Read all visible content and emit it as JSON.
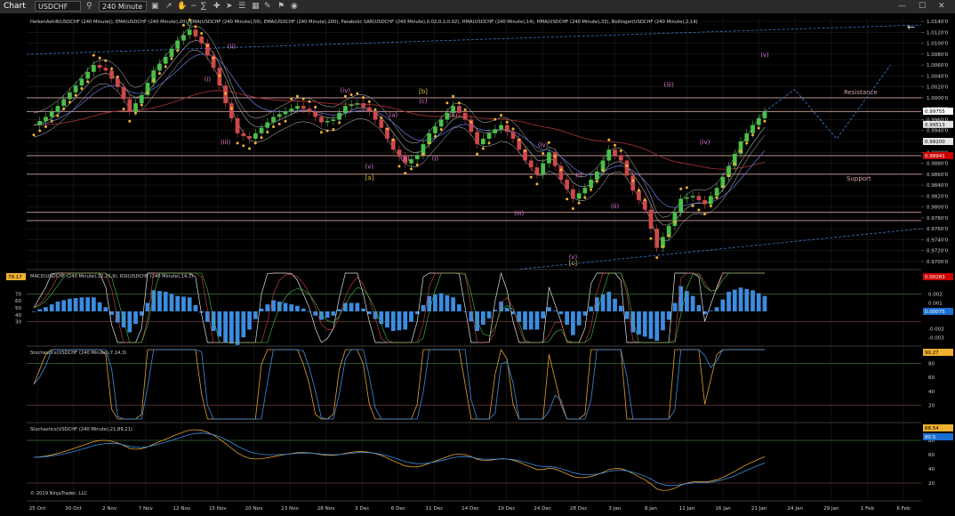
{
  "toolbar": {
    "chart_label": "Chart",
    "symbol": "USDCHF",
    "interval": "240 Minute"
  },
  "panels": {
    "price_label": "HeikenAshi8(USDCHF (240 Minute)), EMA(USDCHF (240 Minute),20), EMA(USDCHF (240 Minute),50), EMA(USDCHF (240 Minute),200), Parabolic SAR(USDCHF (240 Minute),0.02,0.2,0.02), HMA(USDCHF (240 Minute),14), HMA(USDCHF (240 Minute),33), Bollinger(USDCHF (240 Minute),2,14)",
    "macd_label": "MACD(USDCHF (240 Minute),12,26,9), RSI(USDCHF (240 Minute),14,3)",
    "stoch1_label": "Stochastics(USDCHF (240 Minute),7,14,3)",
    "stoch2_label": "Stochastics(USDCHF (240 Minute),21,89,21)",
    "copyright": "© 2019 NinjaTrader, LLC",
    "resistance_label": "Resistance",
    "support_label": "Support"
  },
  "chart_data": {
    "type": "line",
    "symbol": "USDCHF",
    "interval": "240 Minute",
    "x_dates": [
      "25 Oct",
      "30 Oct",
      "2 Nov",
      "7 Nov",
      "12 Nov",
      "15 Nov",
      "20 Nov",
      "23 Nov",
      "28 Nov",
      "3 Dec",
      "6 Dec",
      "11 Dec",
      "14 Dec",
      "19 Dec",
      "24 Dec",
      "28 Dec",
      "3 Jan",
      "8 Jan",
      "11 Jan",
      "16 Jan",
      "21 Jan",
      "24 Jan",
      "29 Jan",
      "1 Feb",
      "6 Feb"
    ],
    "price_axis": {
      "ylim": [
        0.9695,
        1.0145
      ],
      "ticks": [
        "1.0140'0",
        "1.0120'0",
        "1.0100'0",
        "1.0080'0",
        "1.0060'0",
        "1.0040'0",
        "1.0020'0",
        "1.0000'0",
        "0.9980'0",
        "0.9960'0",
        "0.9940'0",
        "0.9920'0",
        "0.9900'0",
        "0.9880'0",
        "0.9860'0",
        "0.9840'0",
        "0.9820'0",
        "0.9800'0",
        "0.9780'0",
        "0.9760'0",
        "0.9740'0",
        "0.9720'0",
        "0.9700'0"
      ],
      "tick_values": [
        1.014,
        1.012,
        1.01,
        1.008,
        1.006,
        1.004,
        1.002,
        1.0,
        0.998,
        0.996,
        0.994,
        0.992,
        0.99,
        0.988,
        0.986,
        0.984,
        0.982,
        0.98,
        0.978,
        0.976,
        0.974,
        0.972,
        0.97
      ],
      "badges": [
        {
          "text": "0.99755",
          "value": 0.99755,
          "bg": "#ffffff",
          "fg": "#000000"
        },
        {
          "text": "0.99513",
          "value": 0.99513,
          "bg": "#e6e6e6",
          "fg": "#000000"
        },
        {
          "text": "0.99200",
          "value": 0.992,
          "bg": "#e6e6e6",
          "fg": "#000000"
        },
        {
          "text": "0.98941",
          "value": 0.98941,
          "bg": "#cc0000",
          "fg": "#ffffff"
        }
      ]
    },
    "close_series": [
      [
        0,
        0.995
      ],
      [
        2,
        0.9965
      ],
      [
        4,
        0.9985
      ],
      [
        6,
        1.001
      ],
      [
        8,
        1.0035
      ],
      [
        10,
        1.006
      ],
      [
        12,
        1.005
      ],
      [
        14,
        1.002
      ],
      [
        16,
        0.9975
      ],
      [
        18,
        1.0005
      ],
      [
        20,
        1.005
      ],
      [
        22,
        1.0075
      ],
      [
        24,
        1.0105
      ],
      [
        26,
        1.0125
      ],
      [
        28,
        1.01
      ],
      [
        30,
        1.0055
      ],
      [
        32,
        0.999
      ],
      [
        34,
        0.9935
      ],
      [
        36,
        0.9925
      ],
      [
        38,
        0.9945
      ],
      [
        40,
        0.9965
      ],
      [
        42,
        0.9975
      ],
      [
        44,
        0.9985
      ],
      [
        46,
        0.9975
      ],
      [
        48,
        0.9955
      ],
      [
        50,
        0.996
      ],
      [
        52,
        0.9985
      ],
      [
        54,
        0.999
      ],
      [
        56,
        0.9975
      ],
      [
        58,
        0.9945
      ],
      [
        60,
        0.9905
      ],
      [
        62,
        0.988
      ],
      [
        64,
        0.9895
      ],
      [
        66,
        0.9935
      ],
      [
        68,
        0.996
      ],
      [
        70,
        0.9985
      ],
      [
        72,
        0.996
      ],
      [
        74,
        0.9915
      ],
      [
        76,
        0.9935
      ],
      [
        78,
        0.995
      ],
      [
        80,
        0.9925
      ],
      [
        82,
        0.9885
      ],
      [
        84,
        0.986
      ],
      [
        86,
        0.99
      ],
      [
        88,
        0.985
      ],
      [
        90,
        0.9815
      ],
      [
        92,
        0.9835
      ],
      [
        94,
        0.9865
      ],
      [
        96,
        0.9905
      ],
      [
        98,
        0.9885
      ],
      [
        100,
        0.983
      ],
      [
        102,
        0.9795
      ],
      [
        104,
        0.9725
      ],
      [
        106,
        0.9765
      ],
      [
        108,
        0.9815
      ],
      [
        110,
        0.982
      ],
      [
        112,
        0.9805
      ],
      [
        114,
        0.9835
      ],
      [
        116,
        0.9875
      ],
      [
        118,
        0.992
      ],
      [
        120,
        0.995
      ],
      [
        122,
        0.9975
      ]
    ],
    "parabolic_sar_bars": [
      0,
      4,
      8,
      12,
      16,
      20,
      24,
      28,
      32,
      36,
      40,
      44,
      48,
      52,
      56,
      60,
      64,
      68,
      72,
      76,
      80,
      84,
      88,
      92,
      96,
      100,
      104,
      108,
      112,
      116,
      120
    ],
    "bar_count": 123,
    "horizontal_levels": [
      {
        "value": 1.0,
        "color": "#d8a0a0"
      },
      {
        "value": 0.9975,
        "color": "#d8a0a0"
      },
      {
        "value": 0.9894,
        "color": "#d8a0a0"
      },
      {
        "value": 0.986,
        "color": "#d8a0a0"
      },
      {
        "value": 0.979,
        "color": "#d8a0a0"
      },
      {
        "value": 0.9775,
        "color": "#d8a0a0"
      }
    ],
    "projection": [
      [
        122,
        0.9975
      ],
      [
        127,
        1.0015
      ],
      [
        134,
        0.9925
      ],
      [
        143,
        1.006
      ]
    ],
    "wave_labels": [
      {
        "text": "D",
        "bar": 26,
        "value": 1.0132,
        "color": "#7fc97f"
      },
      {
        "text": "(ii)",
        "bar": 33,
        "value": 1.009,
        "color": "#e07ad0"
      },
      {
        "text": "(i)",
        "bar": 29,
        "value": 1.003,
        "color": "#e07ad0"
      },
      {
        "text": "(iii)",
        "bar": 32,
        "value": 0.9915,
        "color": "#e07ad0"
      },
      {
        "text": "(iv)",
        "bar": 52,
        "value": 1.001,
        "color": "#e07ad0"
      },
      {
        "text": "(v)",
        "bar": 56,
        "value": 0.987,
        "color": "#e07ad0"
      },
      {
        "text": "[a]",
        "bar": 56,
        "value": 0.985,
        "color": "#e0c040"
      },
      {
        "text": "(a)",
        "bar": 60,
        "value": 0.9965,
        "color": "#e07ad0"
      },
      {
        "text": "(b)",
        "bar": 62,
        "value": 0.9885,
        "color": "#e07ad0"
      },
      {
        "text": "[b]",
        "bar": 65,
        "value": 1.0008,
        "color": "#e0c040"
      },
      {
        "text": "(c)",
        "bar": 65,
        "value": 0.999,
        "color": "#e07ad0"
      },
      {
        "text": "(ii)",
        "bar": 70,
        "value": 0.9965,
        "color": "#e07ad0"
      },
      {
        "text": "(i)",
        "bar": 67,
        "value": 0.9885,
        "color": "#e07ad0"
      },
      {
        "text": "(iv)",
        "bar": 85,
        "value": 0.991,
        "color": "#e07ad0"
      },
      {
        "text": "(iii)",
        "bar": 81,
        "value": 0.9785,
        "color": "#e07ad0"
      },
      {
        "text": "(i)",
        "bar": 91,
        "value": 0.9855,
        "color": "#e07ad0"
      },
      {
        "text": "(ii)",
        "bar": 97,
        "value": 0.9798,
        "color": "#e07ad0"
      },
      {
        "text": "(v)",
        "bar": 90,
        "value": 0.9705,
        "color": "#e07ad0"
      },
      {
        "text": "[c]",
        "bar": 90,
        "value": 0.9693,
        "color": "#e0c040"
      },
      {
        "text": "(iii)",
        "bar": 106,
        "value": 1.002,
        "color": "#e07ad0"
      },
      {
        "text": "(iv)",
        "bar": 112,
        "value": 0.9915,
        "color": "#e07ad0"
      },
      {
        "text": "(v)",
        "bar": 122,
        "value": 1.0075,
        "color": "#e07ad0"
      }
    ],
    "macd_panel": {
      "left_ticks": [
        "70",
        "60",
        "50",
        "40",
        "30"
      ],
      "left_values": [
        70,
        60,
        50,
        40,
        30
      ],
      "right_ticks": [
        "0.002",
        "0.001",
        "-0.002",
        "-0.003"
      ],
      "right_values": [
        0.002,
        0.001,
        -0.002,
        -0.003
      ],
      "rsi_badge": "78.17",
      "badges": [
        {
          "text": "0.00283",
          "bg": "#cc0000",
          "fg": "#ffffff"
        },
        {
          "text": "0.00075",
          "bg": "#1a6fd0",
          "fg": "#ffffff"
        }
      ]
    },
    "stoch1_panel": {
      "ticks": [
        "80",
        "60",
        "40",
        "20"
      ],
      "tick_values": [
        80,
        60,
        40,
        20
      ],
      "badge": "90.27"
    },
    "stoch2_panel": {
      "ticks": [
        "80",
        "60",
        "40",
        "20"
      ],
      "tick_values": [
        80,
        60,
        40,
        20
      ],
      "badges": [
        "88.54",
        "80.5"
      ]
    }
  },
  "colors": {
    "background": "#000000",
    "grid": "#1e1e1e",
    "bull": "#49c04a",
    "bear": "#d04848",
    "sar": "#f0b030",
    "blue_line": "#3c8ce0",
    "orange_line": "#e0a030",
    "ema200": "#9a3030",
    "level": "#d8a0a0"
  }
}
